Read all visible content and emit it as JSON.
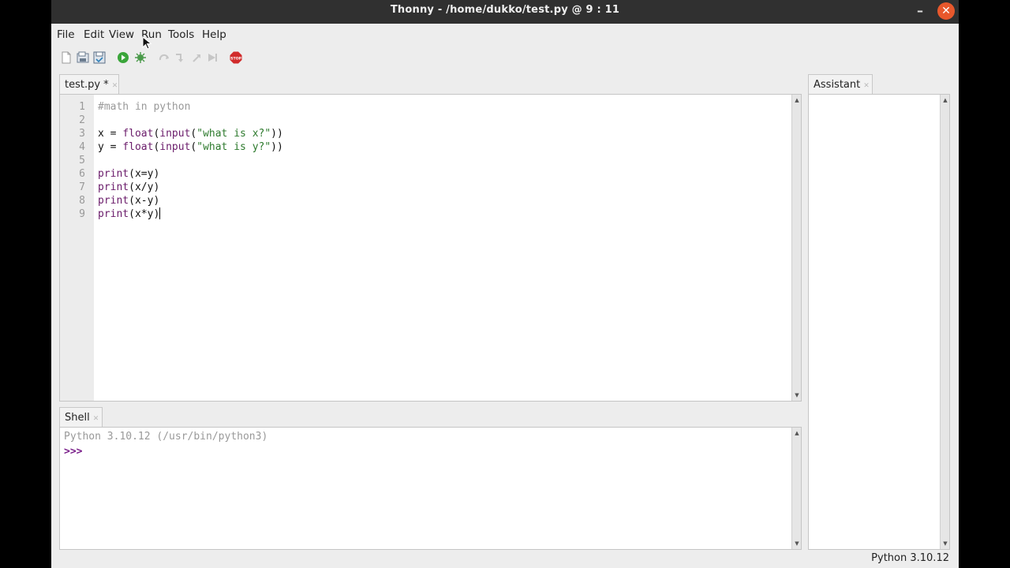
{
  "window": {
    "title": "Thonny  -  /home/dukko/test.py  @  9 : 11",
    "minimize_glyph": "–",
    "close_glyph": "✕"
  },
  "menu": [
    "File",
    "Edit",
    "View",
    "Run",
    "Tools",
    "Help"
  ],
  "toolbar": {
    "icons": [
      "new-file-icon",
      "open-file-icon",
      "save-file-icon",
      "run-icon",
      "debug-icon",
      "step-over-icon",
      "step-into-icon",
      "step-out-icon",
      "resume-icon",
      "stop-icon"
    ],
    "stop_label": "STOP"
  },
  "editor": {
    "tab_label": "test.py *",
    "lines": [
      {
        "no": "1",
        "tokens": [
          {
            "t": "#math in python",
            "c": "comment"
          }
        ]
      },
      {
        "no": "2",
        "tokens": []
      },
      {
        "no": "3",
        "tokens": [
          {
            "t": "x = ",
            "c": ""
          },
          {
            "t": "float",
            "c": "builtin"
          },
          {
            "t": "(",
            "c": ""
          },
          {
            "t": "input",
            "c": "builtin"
          },
          {
            "t": "(",
            "c": ""
          },
          {
            "t": "\"what is x?\"",
            "c": "string"
          },
          {
            "t": "))",
            "c": ""
          }
        ]
      },
      {
        "no": "4",
        "tokens": [
          {
            "t": "y = ",
            "c": ""
          },
          {
            "t": "float",
            "c": "builtin"
          },
          {
            "t": "(",
            "c": ""
          },
          {
            "t": "input",
            "c": "builtin"
          },
          {
            "t": "(",
            "c": ""
          },
          {
            "t": "\"what is y?\"",
            "c": "string"
          },
          {
            "t": "))",
            "c": ""
          }
        ]
      },
      {
        "no": "5",
        "tokens": []
      },
      {
        "no": "6",
        "tokens": [
          {
            "t": "print",
            "c": "builtin"
          },
          {
            "t": "(x=y)",
            "c": ""
          }
        ]
      },
      {
        "no": "7",
        "tokens": [
          {
            "t": "print",
            "c": "builtin"
          },
          {
            "t": "(x/y)",
            "c": ""
          }
        ]
      },
      {
        "no": "8",
        "tokens": [
          {
            "t": "print",
            "c": "builtin"
          },
          {
            "t": "(x-y)",
            "c": ""
          }
        ]
      },
      {
        "no": "9",
        "tokens": [
          {
            "t": "print",
            "c": "builtin"
          },
          {
            "t": "(x*y)",
            "c": ""
          }
        ]
      }
    ]
  },
  "shell": {
    "tab_label": "Shell",
    "banner": "Python 3.10.12 (/usr/bin/python3)",
    "prompt": ">>>"
  },
  "assistant": {
    "tab_label": "Assistant"
  },
  "status": {
    "interpreter": "Python 3.10.12"
  },
  "colors": {
    "titlebar": "#303030",
    "close_button": "#e8582c",
    "builtin": "#6a1b6a",
    "string": "#2d7a2d",
    "comment": "#999999",
    "prompt": "#7a1f8a"
  }
}
